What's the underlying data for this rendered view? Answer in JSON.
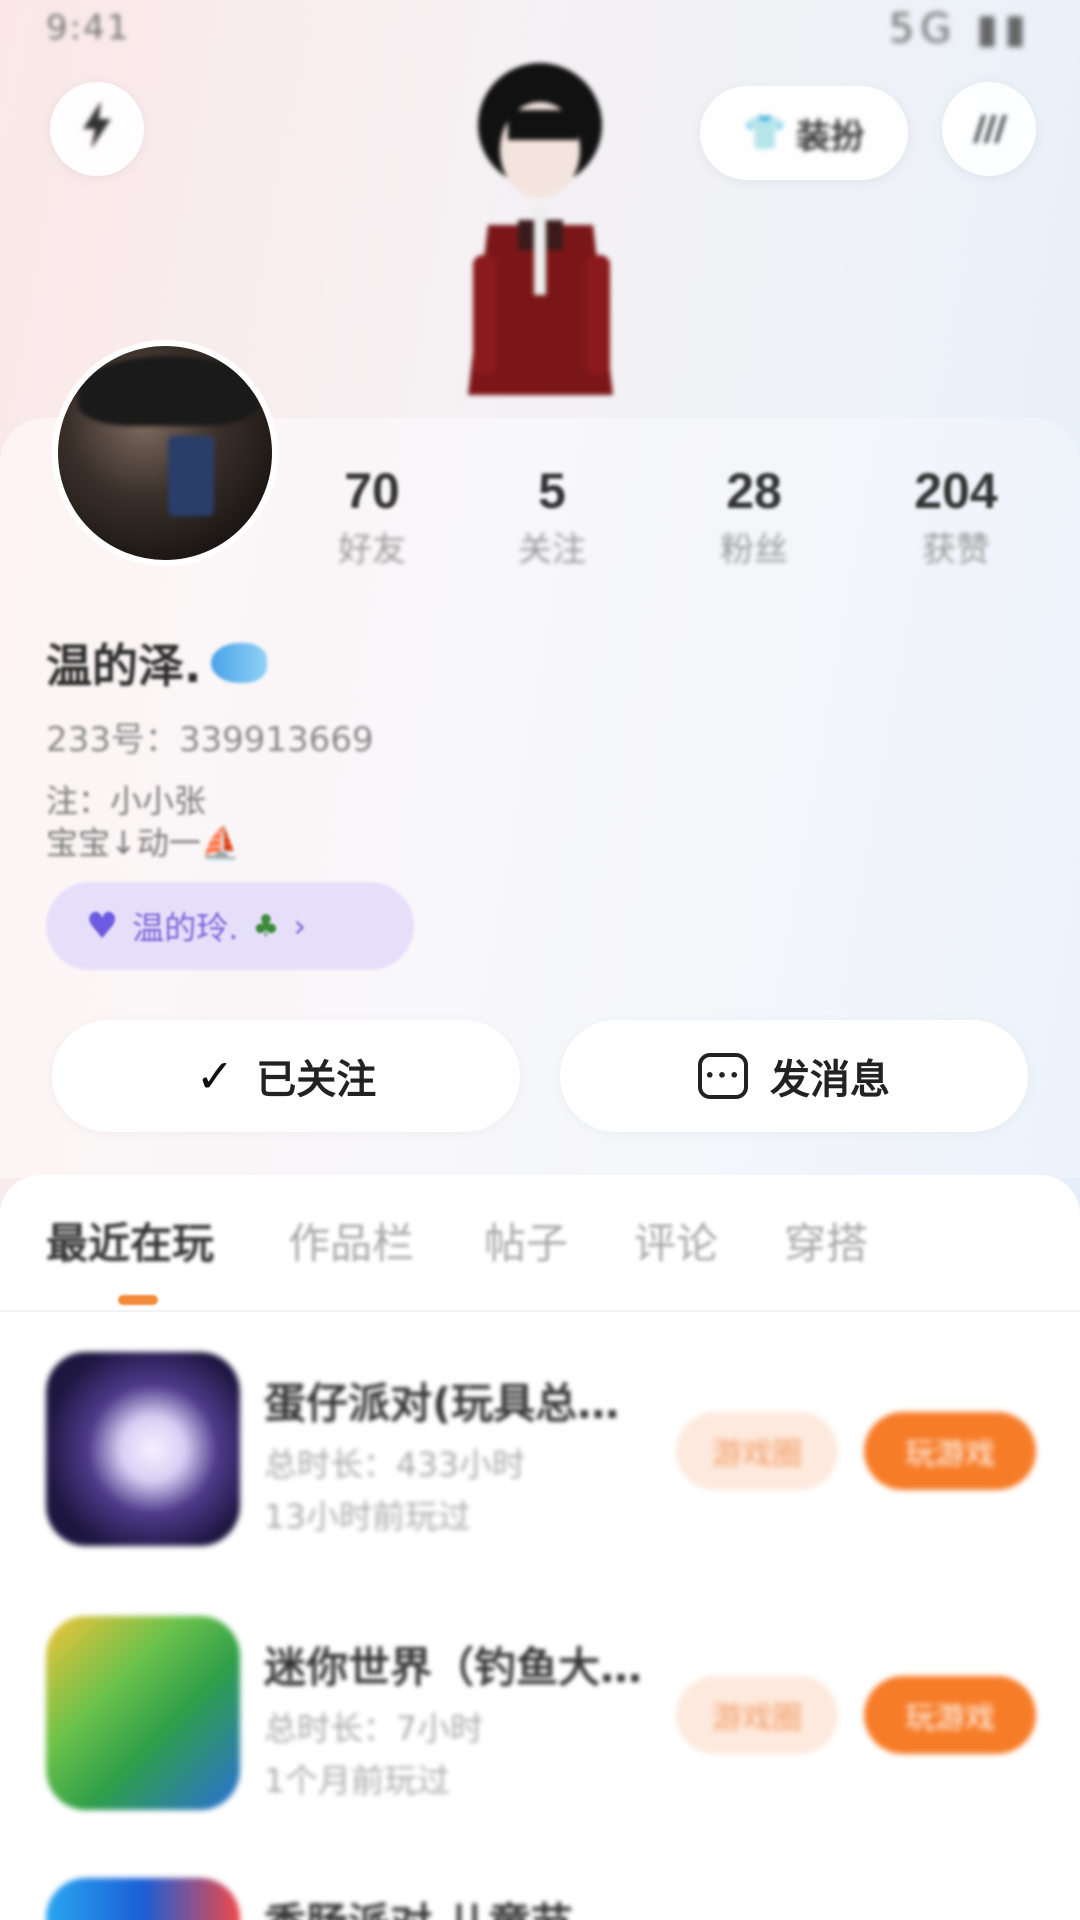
{
  "status_bar": {
    "left": "9:41",
    "right": "5G ▮▮"
  },
  "header": {
    "back_icon": "bolt-icon",
    "outfit_label": "装扮",
    "more_icon": "more-icon"
  },
  "profile": {
    "stats": [
      {
        "value": "70",
        "label": "好友"
      },
      {
        "value": "5",
        "label": "关注"
      },
      {
        "value": "28",
        "label": "粉丝"
      },
      {
        "value": "204",
        "label": "获赞"
      }
    ],
    "nickname": "温的泽.",
    "id_line": "233号：339913669",
    "bio_lines": [
      "注：小小张",
      "宝宝↓动一⛵"
    ],
    "couple_tag": {
      "name": "温的玲.",
      "chevron": "›"
    }
  },
  "actions": {
    "follow_label": "已关注",
    "message_label": "发消息"
  },
  "tabs": [
    {
      "label": "最近在玩",
      "active": true
    },
    {
      "label": "作品栏",
      "active": false
    },
    {
      "label": "帖子",
      "active": false
    },
    {
      "label": "评论",
      "active": false
    },
    {
      "label": "穿搭",
      "active": false
    }
  ],
  "games": [
    {
      "title": "蛋仔派对(玩具总…",
      "duration": "总时长：433小时",
      "last_played": "13小时前玩过",
      "circle_label": "游戏圈",
      "play_label": "玩游戏"
    },
    {
      "title": "迷你世界（钓鱼大…",
      "duration": "总时长：7小时",
      "last_played": "1个月前玩过",
      "circle_label": "游戏圈",
      "play_label": "玩游戏"
    }
  ],
  "peek_game": {
    "title": "香肠派对 儿童节"
  },
  "colors": {
    "accent_orange": "#f77c28",
    "tag_purple": "#e6dffa",
    "tag_text": "#7a62d6"
  }
}
